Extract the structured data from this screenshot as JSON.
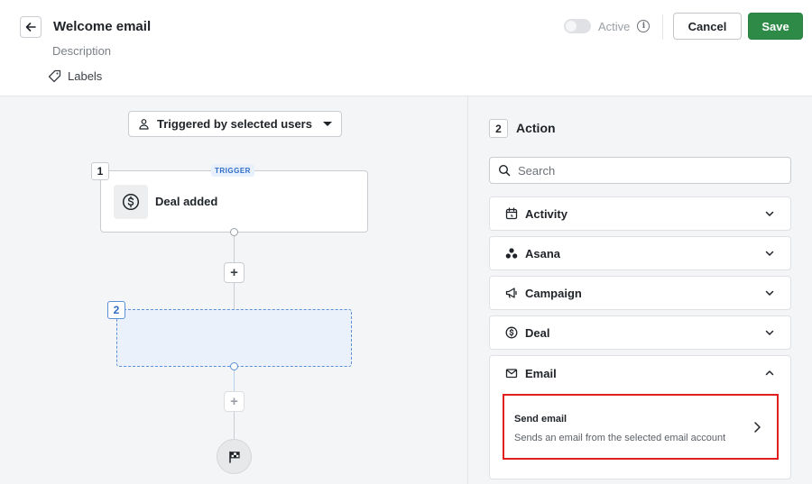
{
  "header": {
    "title": "Welcome email",
    "description": "Description",
    "labels_label": "Labels",
    "active_label": "Active",
    "active_on": false,
    "cancel_label": "Cancel",
    "save_label": "Save",
    "save_color": "#2e8b47"
  },
  "canvas": {
    "trigger_select_label": "Triggered by selected users",
    "nodes": [
      {
        "number": "1",
        "tag": "TRIGGER",
        "label": "Deal added",
        "icon": "dollar-circle-icon"
      },
      {
        "number": "2",
        "label": "",
        "state": "selected-placeholder"
      }
    ],
    "end_icon": "flag-icon"
  },
  "panel": {
    "step_number": "2",
    "title": "Action",
    "search": {
      "placeholder": "Search",
      "value": ""
    },
    "categories": [
      {
        "label": "Activity",
        "icon": "calendar-icon",
        "expanded": false
      },
      {
        "label": "Asana",
        "icon": "asana-icon",
        "expanded": false
      },
      {
        "label": "Campaign",
        "icon": "megaphone-icon",
        "expanded": false
      },
      {
        "label": "Deal",
        "icon": "dollar-circle-icon",
        "expanded": false
      },
      {
        "label": "Email",
        "icon": "envelope-icon",
        "expanded": true
      }
    ],
    "email_actions": [
      {
        "title": "Send email",
        "description": "Sends an email from the selected email account",
        "highlighted": true
      }
    ],
    "highlight_color": "#e0201f"
  }
}
